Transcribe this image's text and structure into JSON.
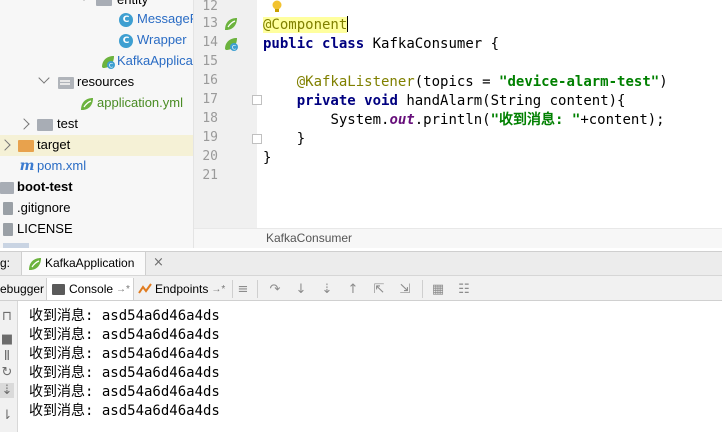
{
  "project_tree": [
    {
      "label": "entity",
      "kind": "folder"
    },
    {
      "label": "MessageF",
      "kind": "class"
    },
    {
      "label": "Wrapper",
      "kind": "class"
    },
    {
      "label": "KafkaApplicat",
      "kind": "spring-class"
    },
    {
      "label": "resources",
      "kind": "resources-folder"
    },
    {
      "label": "application.yml",
      "kind": "yml"
    },
    {
      "label": "test",
      "kind": "folder"
    },
    {
      "label": "target",
      "kind": "excluded-folder"
    },
    {
      "label": "pom.xml",
      "kind": "maven"
    },
    {
      "label": "boot-test",
      "kind": "module"
    },
    {
      "label": ".gitignore",
      "kind": "file"
    },
    {
      "label": "LICENSE",
      "kind": "file"
    }
  ],
  "editor": {
    "line_numbers": [
      "12",
      "13",
      "14",
      "15",
      "16",
      "17",
      "18",
      "19",
      "20",
      "21"
    ],
    "code": {
      "annotation_component": "@Component",
      "public_kw": "public",
      "class_kw": "class",
      "class_decl": "KafkaConsumer {",
      "annotation_listener": "@KafkaListener",
      "topics_prefix": "(topics = ",
      "topic_value": "\"device-alarm-test\"",
      "paren_close": ")",
      "private_kw": "private",
      "void_kw": "void",
      "method_decl": "handAlarm(String content){",
      "system_prefix": "System.",
      "out_field": "out",
      "println_prefix": ".println(",
      "print_string": "\"收到消息: \"",
      "print_suffix": "+content);",
      "close_brace_method": "}",
      "close_brace_class": "}"
    },
    "breadcrumb": "KafkaConsumer"
  },
  "run_panel": {
    "run_label": "g:",
    "config_name": "KafkaApplication",
    "tabs": {
      "debugger": "ebugger",
      "console": "Console",
      "console_arrow": "→*",
      "endpoints": "Endpoints",
      "endpoints_arrow": "→*"
    },
    "console_lines": [
      "收到消息: asd54a6d46a4ds",
      "收到消息: asd54a6d46a4ds",
      "收到消息: asd54a6d46a4ds",
      "收到消息: asd54a6d46a4ds",
      "收到消息: asd54a6d46a4ds",
      "收到消息: asd54a6d46a4ds"
    ]
  }
}
